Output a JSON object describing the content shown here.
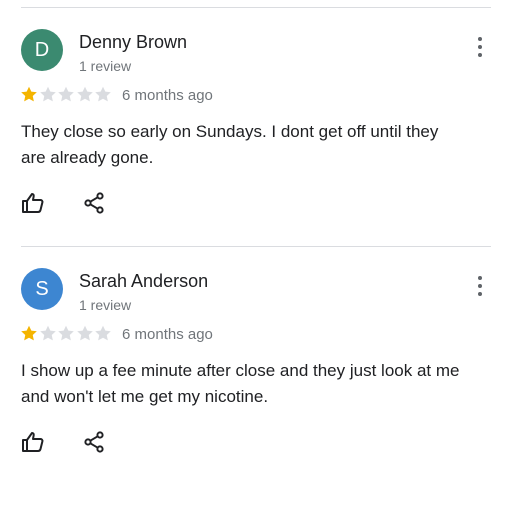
{
  "colors": {
    "star_filled": "#f4b400",
    "star_empty": "#dadce0",
    "secondary_text": "#70757a",
    "divider": "#dadce0"
  },
  "reviews": [
    {
      "avatar_letter": "D",
      "avatar_color": "#3b8a70",
      "name": "Denny Brown",
      "review_count": "1 review",
      "rating": 1,
      "max_rating": 5,
      "time": "6 months ago",
      "text": "They close so early on Sundays. I dont get off until they are already gone.",
      "like_icon": "thumb-up-icon",
      "share_icon": "share-icon",
      "menu_icon": "more-vert-icon"
    },
    {
      "avatar_letter": "S",
      "avatar_color": "#3d86d1",
      "name": "Sarah Anderson",
      "review_count": "1 review",
      "rating": 1,
      "max_rating": 5,
      "time": "6 months ago",
      "text": "I show up a fee minute after close and they just look at me and won't let me get my nicotine.",
      "like_icon": "thumb-up-icon",
      "share_icon": "share-icon",
      "menu_icon": "more-vert-icon"
    }
  ]
}
